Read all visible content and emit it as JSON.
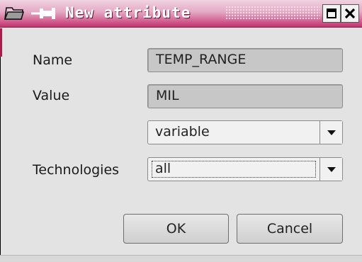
{
  "window": {
    "title": "New attribute",
    "colors": {
      "titlebar_accent": "#c4326f",
      "field_disabled": "#c7c7c7",
      "window_bg": "#e3e3e3"
    }
  },
  "form": {
    "name": {
      "label": "Name",
      "value": "TEMP_RANGE"
    },
    "value": {
      "label": "Value",
      "value": "MIL"
    },
    "type": {
      "selected": "variable"
    },
    "technologies": {
      "label": "Technologies",
      "selected": "all"
    }
  },
  "buttons": {
    "ok": "OK",
    "cancel": "Cancel"
  },
  "icons": {
    "window_icon": "folder-icon",
    "pin": "pin-icon",
    "maximize": "maximize-icon",
    "close": "close-icon",
    "dropdown": "chevron-down-icon"
  }
}
